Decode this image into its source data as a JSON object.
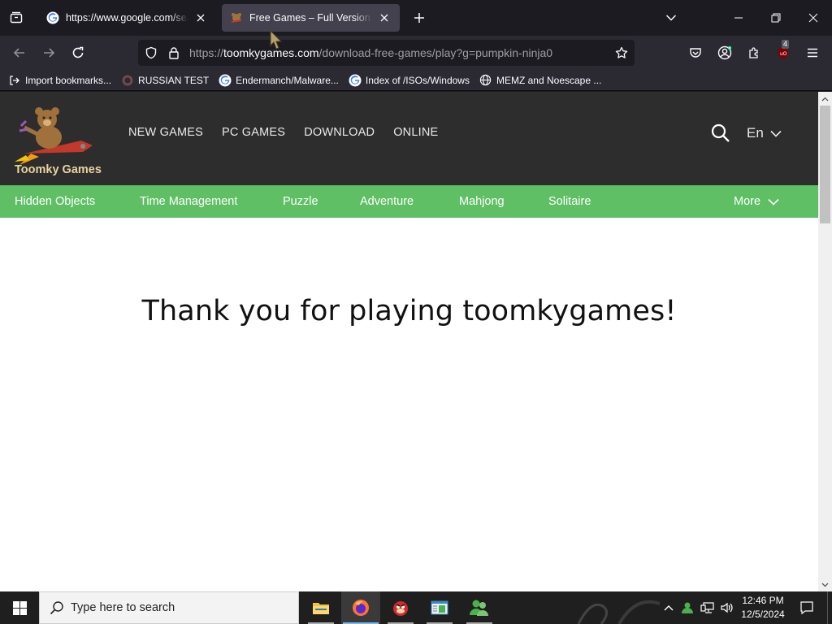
{
  "browser": {
    "tabs": [
      {
        "title": "https://www.google.com/search",
        "favicon": "google-g-icon",
        "active": false
      },
      {
        "title": "Free Games – Full Version PC Games",
        "favicon": "toomky-bear-icon",
        "active": true
      }
    ],
    "url": {
      "scheme": "https://",
      "host": "toomkygames.com",
      "path": "/download-free-games/play?g=pumpkin-ninja0"
    },
    "extension_badge": "4",
    "bookmarks": [
      {
        "label": "Import bookmarks...",
        "icon": "import-icon"
      },
      {
        "label": "RUSSIAN TEST",
        "icon": "github-octocat-icon"
      },
      {
        "label": "Endermanch/Malware...",
        "icon": "google-g-icon"
      },
      {
        "label": "Index of /ISOs/Windows",
        "icon": "google-g-icon"
      },
      {
        "label": "MEMZ and Noescape ...",
        "icon": "globe-icon"
      }
    ]
  },
  "site": {
    "logo_text": "Toomky Games",
    "nav": [
      "NEW GAMES",
      "PC GAMES",
      "DOWNLOAD",
      "ONLINE"
    ],
    "language": "En",
    "categories": [
      "Hidden Objects",
      "Time Management",
      "Puzzle",
      "Adventure",
      "Mahjong",
      "Solitaire"
    ],
    "more_label": "More",
    "message": "Thank you for playing toomkygames!",
    "colors": {
      "header": "#2d2d2d",
      "category_bar": "#5ebf64",
      "logo_text": "#ead3a0"
    }
  },
  "taskbar": {
    "search_placeholder": "Type here to search",
    "time": "12:46 PM",
    "date": "12/5/2024",
    "apps": [
      "file-explorer-icon",
      "firefox-icon",
      "angry-bird-app-icon",
      "notepad-app-icon",
      "people-app-icon"
    ]
  }
}
